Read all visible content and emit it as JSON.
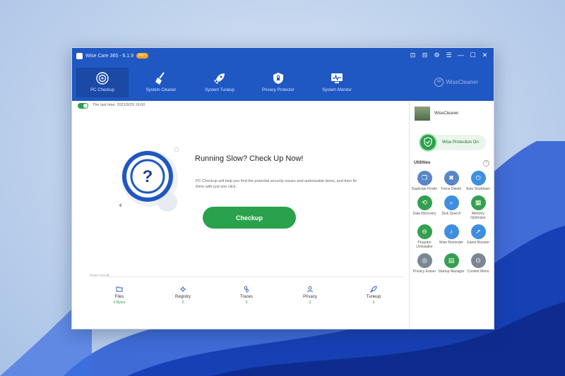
{
  "app": {
    "title": "Wise Care 365 - 6.1.9",
    "badge": "PRO",
    "controls": [
      "⊡",
      "⊟",
      "⚙",
      "☰",
      "—",
      "☐",
      "✕"
    ]
  },
  "nav": [
    {
      "label": "PC Checkup",
      "icon": "target-icon",
      "active": true
    },
    {
      "label": "System Cleaner",
      "icon": "broom-icon",
      "active": false
    },
    {
      "label": "System Tuneup",
      "icon": "rocket-icon",
      "active": false
    },
    {
      "label": "Privacy Protector",
      "icon": "shield-lock-icon",
      "active": false
    },
    {
      "label": "System Monitor",
      "icon": "monitor-icon",
      "active": false
    }
  ],
  "brand": {
    "name": "WiseCleaner",
    "logo_letter": "W"
  },
  "main": {
    "last_time": "The last time: 2021/9/29 16:00",
    "headline": "Running Slow? Check Up Now!",
    "description": "PC Checkup will help you find the potential security issues and optimizable items, and then fix them with just one click.",
    "button_label": "Checkup",
    "scan_label": "Scan result"
  },
  "categories": [
    {
      "label": "Files",
      "value": "0 Bytes",
      "icon": "folder-icon"
    },
    {
      "label": "Registry",
      "value": "0",
      "icon": "registry-icon"
    },
    {
      "label": "Traces",
      "value": "0",
      "icon": "footprint-icon"
    },
    {
      "label": "Privacy",
      "value": "0",
      "icon": "user-icon"
    },
    {
      "label": "Tuneup",
      "value": "0",
      "icon": "rocket-icon"
    }
  ],
  "sidebar": {
    "user_name": "WiseCleaner",
    "protection_label": "Wise Protection On",
    "utilities_title": "Utilities",
    "utilities": [
      {
        "label": "Duplicate Finder",
        "icon": "duplicate-icon",
        "color": "#5a86c8"
      },
      {
        "label": "Force Delete",
        "icon": "trash-icon",
        "color": "#5a86c8"
      },
      {
        "label": "Auto Shutdown",
        "icon": "power-icon",
        "color": "#3e8fe0"
      },
      {
        "label": "Data Recovery",
        "icon": "recovery-icon",
        "color": "#33a04f"
      },
      {
        "label": "Disk Search",
        "icon": "search-icon",
        "color": "#3e8fe0"
      },
      {
        "label": "Memory Optimizer",
        "icon": "memory-icon",
        "color": "#33a04f"
      },
      {
        "label": "Program Uninstaller",
        "icon": "uninstall-icon",
        "color": "#33a04f"
      },
      {
        "label": "Wise Reminder",
        "icon": "bell-icon",
        "color": "#3e8fe0"
      },
      {
        "label": "Game Booster",
        "icon": "rocket-icon",
        "color": "#3e8fe0"
      },
      {
        "label": "Privacy Eraser",
        "icon": "eye-off-icon",
        "color": "#7b8694"
      },
      {
        "label": "Startup Manager",
        "icon": "startup-icon",
        "color": "#33a04f"
      },
      {
        "label": "Context Menu",
        "icon": "mouse-icon",
        "color": "#7b8694"
      }
    ]
  }
}
